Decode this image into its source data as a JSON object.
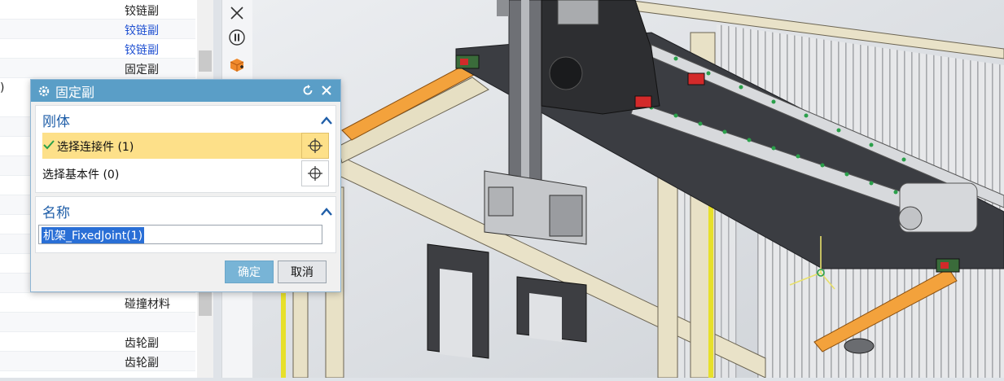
{
  "nav": {
    "rows": [
      {
        "label": "铰链副",
        "style": "normal"
      },
      {
        "label": "铰链副",
        "style": "blue"
      },
      {
        "label": "铰链副",
        "style": "blue"
      },
      {
        "label": "固定副",
        "style": "normal"
      },
      {
        "label": "碰撞材料",
        "style": "normal"
      },
      {
        "label": "齿轮副",
        "style": "normal"
      },
      {
        "label": "齿轮副",
        "style": "normal"
      }
    ],
    "paren": ")"
  },
  "dialog": {
    "title": "固定副",
    "rigid_group": {
      "label": "刚体",
      "select_connected": "选择连接件 (1)",
      "select_base": "选择基本件 (0)"
    },
    "name_group": {
      "label": "名称",
      "value": "机架_FixedJoint(1)"
    },
    "ok_label": "确定",
    "cancel_label": "取消"
  },
  "colors": {
    "title_bar": "#5a9ec7",
    "selected_row": "#fde089",
    "group_label": "#1f5ea8",
    "ok_button": "#78b4d6",
    "frame_beam": "#e9e2c8",
    "conveyor_orange": "#f3a23c"
  },
  "toolbar": {
    "icons": [
      "close-icon",
      "pause-icon",
      "component-move-icon"
    ]
  }
}
